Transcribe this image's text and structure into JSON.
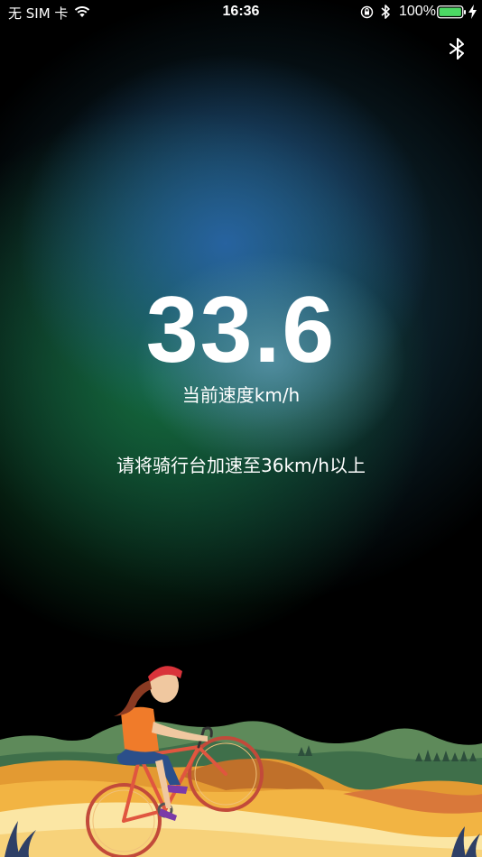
{
  "status_bar": {
    "carrier": "无 SIM 卡",
    "time": "16:36",
    "battery": "100%",
    "icons": [
      "wifi-icon",
      "orientation-lock-icon",
      "bluetooth-icon",
      "battery-icon",
      "charging-icon"
    ]
  },
  "header": {
    "bluetooth_icon": "bluetooth-icon"
  },
  "speed": {
    "value": "33.6",
    "label": "当前速度km/h"
  },
  "instruction": "请将骑行台加速至36km/h以上",
  "colors": {
    "background": "#000000",
    "glow_blue": "#2864a5",
    "glow_green": "#146e3c",
    "battery_green": "#4cd964",
    "text": "#ffffff"
  }
}
